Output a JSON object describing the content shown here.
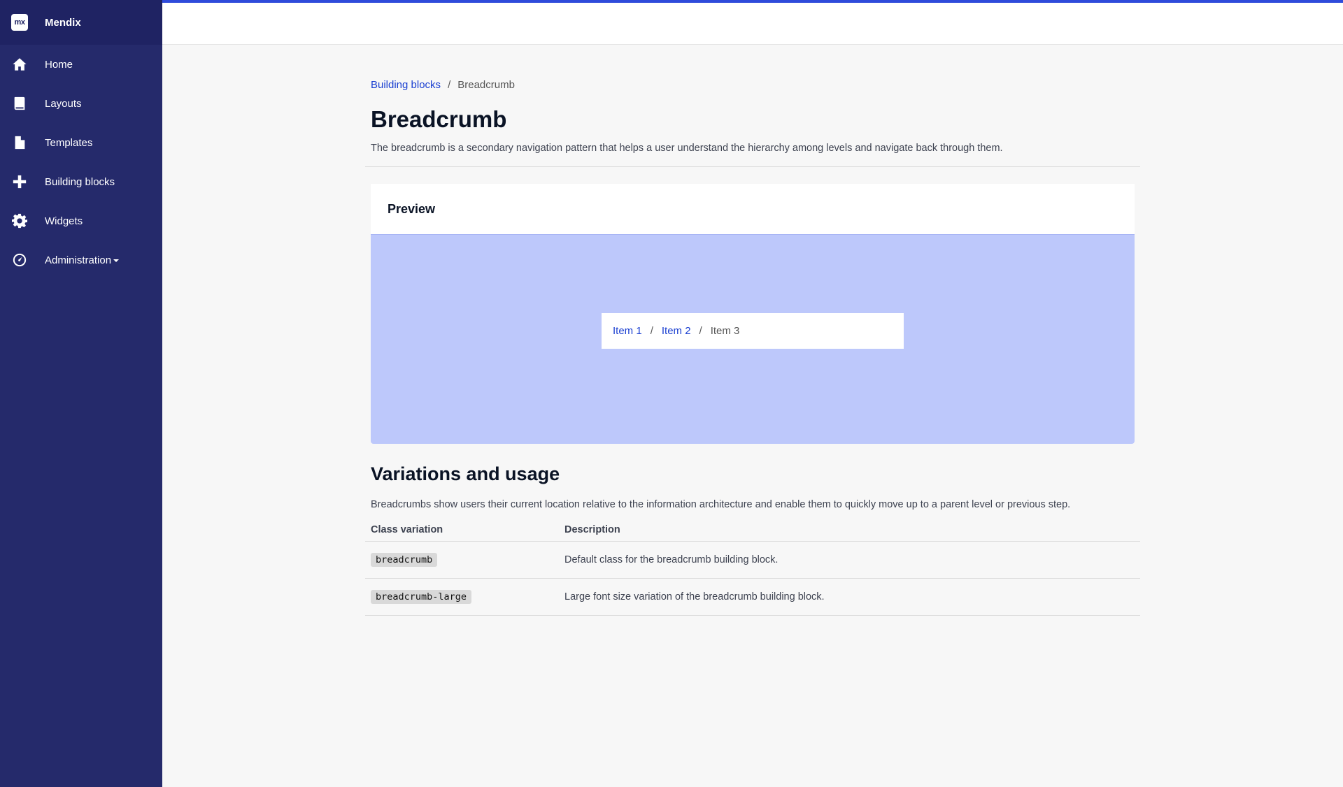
{
  "brand": {
    "name": "Mendix",
    "logo_text": "mx"
  },
  "sidebar": {
    "items": [
      {
        "label": "Home",
        "icon": "home-icon"
      },
      {
        "label": "Layouts",
        "icon": "book-icon"
      },
      {
        "label": "Templates",
        "icon": "file-icon"
      },
      {
        "label": "Building blocks",
        "icon": "plus-icon"
      },
      {
        "label": "Widgets",
        "icon": "gear-icon"
      },
      {
        "label": "Administration",
        "icon": "dashboard-icon",
        "has_dropdown": true
      }
    ]
  },
  "breadcrumb": {
    "link": "Building blocks",
    "separator": "/",
    "current": "Breadcrumb"
  },
  "page": {
    "title": "Breadcrumb",
    "description": "The breadcrumb is a secondary navigation pattern that helps a user understand the hierarchy among levels and navigate back through them."
  },
  "preview": {
    "title": "Preview",
    "demo": {
      "item1": "Item 1",
      "item2": "Item 2",
      "item3": "Item 3",
      "separator": "/"
    }
  },
  "variations": {
    "title": "Variations and usage",
    "description": "Breadcrumbs show users their current location relative to the information architecture and enable them to quickly move up to a parent level or previous step.",
    "headers": {
      "col1": "Class variation",
      "col2": "Description"
    },
    "rows": [
      {
        "class": "breadcrumb",
        "description": "Default class for the breadcrumb building block."
      },
      {
        "class": "breadcrumb-large",
        "description": "Large font size variation of the breadcrumb building block."
      }
    ]
  },
  "colors": {
    "sidebar": "#252a6b",
    "brand_bar": "#1f2363",
    "accent": "#2f4bdb",
    "link": "#1a3fd1",
    "preview_bg": "#bdc8fb"
  }
}
